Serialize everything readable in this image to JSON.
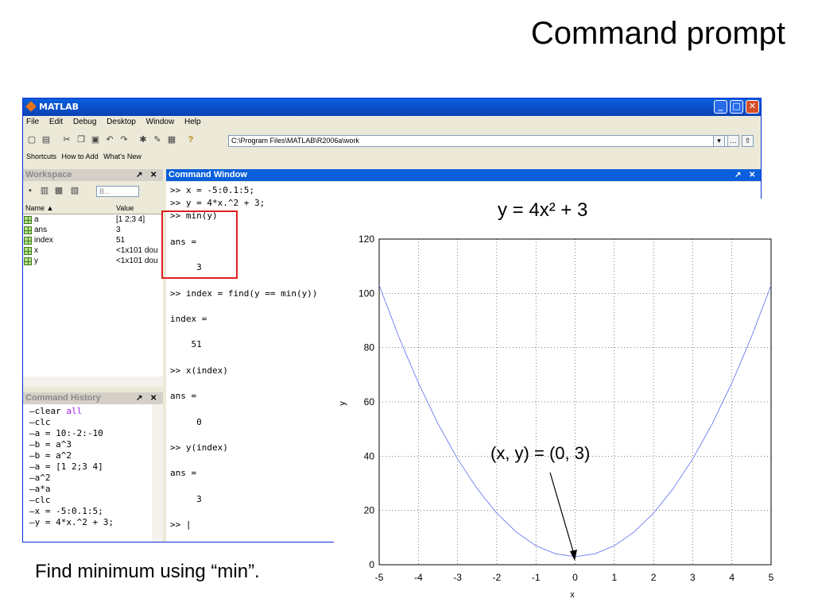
{
  "slide": {
    "title": "Command prompt",
    "caption": "Find minimum using “min”."
  },
  "window": {
    "title": "MATLAB",
    "menu": [
      "File",
      "Edit",
      "Debug",
      "Desktop",
      "Window",
      "Help"
    ],
    "current_folder": "C:\\Program Files\\MATLAB\\R2006a\\work",
    "shortcuts": [
      "Shortcuts",
      "How to Add",
      "What's New"
    ]
  },
  "workspace": {
    "title": "Workspace",
    "columns": [
      "Name ▲",
      "Value"
    ],
    "filter_value": "B...",
    "rows": [
      {
        "name": "a",
        "value": "[1 2;3 4]"
      },
      {
        "name": "ans",
        "value": "3"
      },
      {
        "name": "index",
        "value": "51"
      },
      {
        "name": "x",
        "value": "<1x101 dou"
      },
      {
        "name": "y",
        "value": "<1x101 dou"
      }
    ]
  },
  "history": {
    "title": "Command History",
    "lines": [
      {
        "text": "clear ",
        "kw": "all"
      },
      {
        "text": "clc"
      },
      {
        "text": "a = 10:-2:-10"
      },
      {
        "text": "b = a^3"
      },
      {
        "text": "b = a^2"
      },
      {
        "text": "a = [1 2;3 4]"
      },
      {
        "text": "a^2"
      },
      {
        "text": "a*a"
      },
      {
        "text": "clc"
      },
      {
        "text": "x = -5:0.1:5;"
      },
      {
        "text": "y = 4*x.^2 + 3;"
      }
    ]
  },
  "command_window": {
    "title": "Command Window",
    "lines": [
      ">> x = -5:0.1:5;",
      ">> y = 4*x.^2 + 3;",
      ">> min(y)",
      "",
      "ans =",
      "",
      "     3",
      "",
      ">> index = find(y == min(y))",
      "",
      "index =",
      "",
      "    51",
      "",
      ">> x(index)",
      "",
      "ans =",
      "",
      "     0",
      "",
      ">> y(index)",
      "",
      "ans =",
      "",
      "     3",
      "",
      ">> |"
    ]
  },
  "chart_data": {
    "type": "line",
    "title": "y = 4x² + 3",
    "xlabel": "x",
    "ylabel": "y",
    "xlim": [
      -5,
      5
    ],
    "ylim": [
      0,
      120
    ],
    "xticks": [
      -5,
      -4,
      -3,
      -2,
      -1,
      0,
      1,
      2,
      3,
      4,
      5
    ],
    "yticks": [
      0,
      20,
      40,
      60,
      80,
      100,
      120
    ],
    "grid": true,
    "series": [
      {
        "color": "#5a6cf0",
        "x": [
          -5,
          -4.5,
          -4,
          -3.5,
          -3,
          -2.5,
          -2,
          -1.5,
          -1,
          -0.5,
          0,
          0.5,
          1,
          1.5,
          2,
          2.5,
          3,
          3.5,
          4,
          4.5,
          5
        ],
        "values": [
          103,
          84,
          67,
          52,
          39,
          28,
          19,
          12,
          7,
          4,
          3,
          4,
          7,
          12,
          19,
          28,
          39,
          52,
          67,
          84,
          103
        ]
      }
    ],
    "annotation": {
      "text": "(x, y) = (0, 3)",
      "x": 0,
      "y": 3
    }
  }
}
